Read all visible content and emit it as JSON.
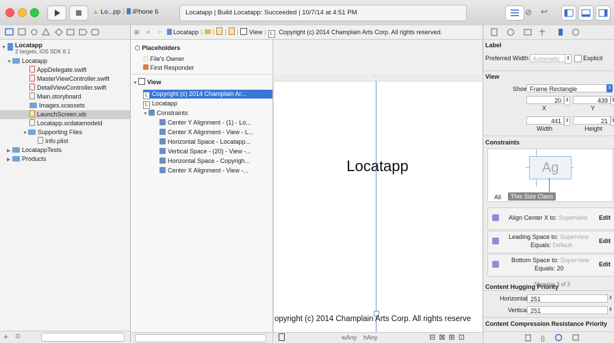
{
  "toolbar": {
    "scheme_target": "Lo...pp",
    "scheme_device": "iPhone 6",
    "activity_text": "Locatapp  |  Build Locatapp: Succeeded  |  10/7/14 at 4:51 PM"
  },
  "navigator": {
    "project_name": "Locatapp",
    "project_sub": "2 targets, iOS SDK 8.1",
    "group_locatapp": "Locatapp",
    "files": [
      "AppDelegate.swift",
      "MasterViewController.swift",
      "DetailViewController.swift",
      "Main.storyboard",
      "Images.xcassets",
      "LaunchScreen.xib",
      "Locatapp.xcdatamodeld"
    ],
    "supporting_files": "Supporting Files",
    "info_plist": "Info.plist",
    "tests": "LocatappTests",
    "products": "Products"
  },
  "jumpbar": {
    "project": "Locatapp",
    "view": "View",
    "label": "Copyright (c) 2014 Champlain Arts Corp. All rights reserved."
  },
  "outline": {
    "placeholders": "Placeholders",
    "files_owner": "File's Owner",
    "first_responder": "First Responder",
    "view": "View",
    "label_copyright": "Copyright (c) 2014 Champlain Ar...",
    "label_locatapp": "Locatapp",
    "constraints": "Constraints",
    "constraint_items": [
      "Center Y Alignment - (1) - Lo...",
      "Center X Alignment - View - L...",
      "Horizontal Space - Locatapp...",
      "Vertical Space - (20) - View -...",
      "Horizontal Space -  Copyrigh...",
      "Center X Alignment - View -..."
    ]
  },
  "canvas": {
    "title": "Locatapp",
    "copyright": "opyright (c) 2014 Champlain Arts Corp. All rights reserve",
    "size_w": "wAny",
    "size_h": "hAny"
  },
  "inspector": {
    "label_section": "Label",
    "preferred_width": "Preferred Width",
    "automatic": "Automatic",
    "explicit": "Explicit",
    "view_section": "View",
    "show": "Show",
    "show_value": "Frame Rectangle",
    "x_value": "20",
    "y_value": "439",
    "x_label": "X",
    "y_label": "Y",
    "width_value": "441",
    "height_value": "21",
    "width_label": "Width",
    "height_label": "Height",
    "constraints_section": "Constraints",
    "ag": "Ag",
    "all": "All",
    "this_size_class": "This Size Class",
    "c1_title": "Align Center X to:",
    "c1_target": "Superview",
    "c2_title": "Leading Space to:",
    "c2_target": "Superview",
    "c2_equals": "Equals:",
    "c2_equals_val": "Default",
    "c3_title": "Bottom Space to:",
    "c3_target": "Superview",
    "c3_equals": "Equals:",
    "c3_equals_val": "20",
    "edit": "Edit",
    "showing": "Showing 3 of 3",
    "hugging_section": "Content Hugging Priority",
    "horizontal": "Horizontal",
    "vertical": "Vertical",
    "h_priority": "251",
    "v_priority": "251",
    "compression_section": "Content Compression Resistance Priority"
  }
}
